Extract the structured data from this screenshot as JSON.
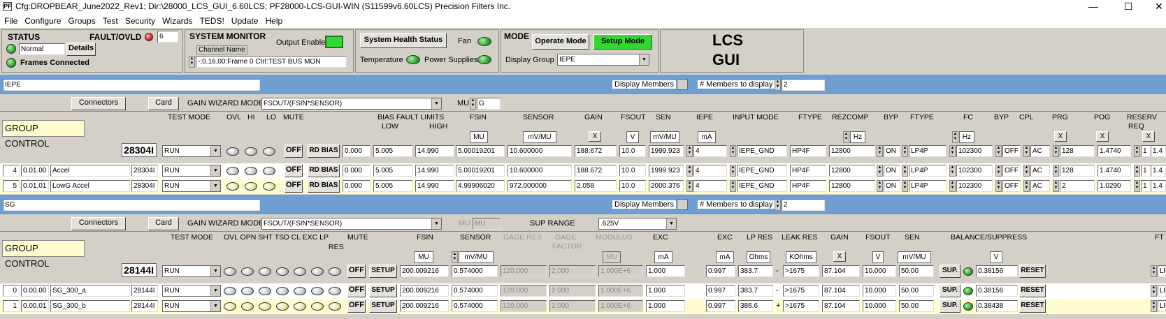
{
  "window": {
    "title": "Cfg:DROPBEAR_June2022_Rev1; Dir:\\28000_LCS_GUI_6.60LCS;   PF28000-LCS-GUI-WIN (S11599v6.60LCS) Precision Filters Inc.",
    "logo": "PF",
    "minimize": "—",
    "maximize": "☐",
    "close": "✕"
  },
  "menu": [
    "File",
    "Configure",
    "Groups",
    "Test",
    "Security",
    "Wizards",
    "TEDS!",
    "Update",
    "Help"
  ],
  "status": {
    "title": "STATUS",
    "fault_label": "FAULT/OVLD",
    "fault_count": "6",
    "state": "Normal",
    "details": "Details",
    "frames": "Frames Connected"
  },
  "monitor": {
    "title": "SYSTEM MONITOR",
    "channel_name_label": "Channel Name",
    "output_enable": "Output Enable",
    "channel_value": "-:0.16.00:Frame 0 Ctrl:TEST BUS MON"
  },
  "health": {
    "button": "System Health Status",
    "fan": "Fan",
    "temperature": "Temperature",
    "power": "Power Supplies"
  },
  "mode": {
    "title": "MODE",
    "operate": "Operate Mode",
    "setup": "Setup Mode",
    "display_group_label": "Display Group",
    "display_group_value": "IEPE"
  },
  "lcs": {
    "line1": "LCS",
    "line2": "GUI"
  },
  "iepe": {
    "name": "IEPE",
    "display_members": "Display Members",
    "members_label": "# Members to display",
    "members_value": "2",
    "connectors": "Connectors",
    "card": "Card",
    "wizard_label": "GAIN WIZARD MODE",
    "wizard_value": "FSOUT/(FSIN*SENSOR)",
    "mu_label": "MU",
    "mu_value": "G",
    "group_control": "GROUP CONTROL",
    "card_id": "28304I",
    "headers": {
      "test_mode": "TEST MODE",
      "ovl": "OVL",
      "hi": "HI",
      "lo": "LO",
      "mute": "MUTE",
      "bias": "BIAS FAULT LIMITS",
      "low": "LOW",
      "high": "HIGH",
      "fsin": "FSIN",
      "sensor": "SENSOR",
      "gain": "GAIN",
      "fsout": "FSOUT",
      "sen": "SEN",
      "iepe": "IEPE",
      "input_mode": "INPUT MODE",
      "ftype": "FTYPE",
      "rezcomp": "REZCOMP",
      "byp": "BYP",
      "ftype2": "FTYPE",
      "fc": "FC",
      "byp2": "BYP",
      "cpl": "CPL",
      "prg": "PRG",
      "pog": "POG",
      "reserv": "RESERV",
      "req": "REQ"
    },
    "units": {
      "fsin": "MU",
      "sensor": "mV/MU",
      "gain": "X",
      "fsout": "V",
      "sen": "mV/MU",
      "iepe": "mA",
      "rez": "Hz",
      "fc": "Hz",
      "prg": "X",
      "pog": "X",
      "res": "X"
    },
    "control_row": {
      "test_mode": "RUN",
      "mute": "OFF",
      "rdbias": "RD BIAS",
      "bias": "0.000",
      "low": "5.005",
      "high": "14.990",
      "fsin": "5.00019201",
      "sensor": "10.600000",
      "gain": "188.672",
      "fsout": "10.0",
      "sen": "1999.923",
      "iepe": "4",
      "input_mode": "IEPE_GND",
      "ftype": "HP4F",
      "rez": "12800",
      "byp": "ON",
      "ftype2": "LP4P",
      "fc": "102300",
      "byp2": "OFF",
      "cpl": "AC",
      "prg": "128",
      "pog": "1.4740",
      "req": "1",
      "extra": "1.4"
    },
    "rows": [
      {
        "num": "4",
        "addr": "0.01.00",
        "name": "Accel",
        "card": "28304I",
        "test_mode": "RUN",
        "mute": "OFF",
        "rdbias": "RD BIAS",
        "bias": "0.000",
        "low": "5.005",
        "high": "14.990",
        "fsin": "5.00019201",
        "sensor": "10.600000",
        "gain": "188.672",
        "fsout": "10.0",
        "sen": "1999.923",
        "iepe": "4",
        "input_mode": "IEPE_GND",
        "ftype": "HP4F",
        "rez": "12800",
        "byp": "ON",
        "ftype2": "LP4P",
        "fc": "102300",
        "byp2": "OFF",
        "cpl": "AC",
        "prg": "128",
        "pog": "1.4740",
        "req": "1",
        "extra": "1.4"
      },
      {
        "num": "5",
        "addr": "0.01.01",
        "name": "LowG Accel",
        "card": "28304I",
        "test_mode": "RUN",
        "mute": "OFF",
        "rdbias": "RD BIAS",
        "bias": "0.000",
        "low": "5.005",
        "high": "14.990",
        "fsin": "4.99906020",
        "sensor": "972.000000",
        "gain": "2.058",
        "fsout": "10.0",
        "sen": "2000.376",
        "iepe": "4",
        "input_mode": "IEPE_GND",
        "ftype": "HP4F",
        "rez": "12800",
        "byp": "ON",
        "ftype2": "LP4P",
        "fc": "102300",
        "byp2": "OFF",
        "cpl": "AC",
        "prg": "2",
        "pog": "1.0290",
        "req": "1",
        "extra": "1.4"
      }
    ]
  },
  "sg": {
    "name": "SG",
    "display_members": "Display Members",
    "members_label": "# Members to display",
    "members_value": "2",
    "connectors": "Connectors",
    "card": "Card",
    "wizard_label": "GAIN WIZARD MODE",
    "wizard_value": "FSOUT/(FSIN*SENSOR)",
    "mu_label": "MU",
    "mu_value": "MU",
    "sup_range_label": "SUP RANGE",
    "sup_range_value": ".625V",
    "group_control": "GROUP CONTROL",
    "card_id": "28144I",
    "headers": {
      "test_mode": "TEST MODE",
      "leds": "OVL OPN SHT TSD  CL   EXC LP",
      "res": "RES",
      "mute": "MUTE",
      "fsin": "FSIN",
      "sensor": "SENSOR",
      "gage_res": "GAGE RES",
      "gage_factor": "GAGE",
      "gage_factor2": "FACTOR",
      "modulus": "MODULUS",
      "exc": "EXC",
      "exc2": "EXC",
      "lp_res": "LP RES",
      "leak_res": "LEAK RES",
      "gain": "GAIN",
      "fsout": "FSOUT",
      "sen": "SEN",
      "balance": "BALANCE/SUPPRESS",
      "ft": "FT"
    },
    "units": {
      "fsin": "MU",
      "sensor": "mV/MU",
      "modulus": "MU",
      "exc": "mA",
      "exc2": "mA",
      "lp": "Ohms",
      "leak": "KOhms",
      "gain": "X",
      "fsout": "V",
      "sen": "mV/MU",
      "bal": "V"
    },
    "control_row": {
      "test_mode": "RUN",
      "mute": "OFF",
      "setup": "SETUP",
      "fsin": "200.009216",
      "sensor": "0.574000",
      "gage_res": "120.000",
      "gage_factor": "2.000",
      "modulus": "1.000E+6",
      "exc": "1.000",
      "exc2": "0.997",
      "lp": "383.7",
      "sign": "-",
      "leak": ">1675",
      "gain": "87.104",
      "fsout": "10.000",
      "sen": "50.00",
      "sup": "SUP.",
      "bal": "0.38156",
      "reset": "RESET",
      "ft": "LF"
    },
    "rows": [
      {
        "num": "0",
        "addr": "0.00.00",
        "name": "SG_300_a",
        "card": "28144I",
        "test_mode": "RUN",
        "mute": "OFF",
        "setup": "SETUP",
        "fsin": "200.009216",
        "sensor": "0.574000",
        "gage_res": "120.000",
        "gage_factor": "2.000",
        "modulus": "1.000E+6",
        "exc": "1.000",
        "exc2": "0.997",
        "lp": "383.7",
        "sign": "-",
        "leak": ">1675",
        "gain": "87.104",
        "fsout": "10.000",
        "sen": "50.00",
        "sup": "SUP.",
        "bal": "0.38156",
        "reset": "RESET",
        "ft": "LF"
      },
      {
        "num": "1",
        "addr": "0.00.01",
        "name": "SG_300_b",
        "card": "28144I",
        "test_mode": "RUN",
        "mute": "OFF",
        "setup": "SETUP",
        "fsin": "200.009216",
        "sensor": "0.574000",
        "gage_res": "120.000",
        "gage_factor": "2.000",
        "modulus": "1.000E+6",
        "exc": "1.000",
        "exc2": "0.997",
        "lp": "386.6",
        "sign": "+",
        "leak": ">1675",
        "gain": "87.104",
        "fsout": "10.000",
        "sen": "50.00",
        "sup": "SUP.",
        "bal": "0.38438",
        "reset": "RESET",
        "ft": "LF"
      }
    ]
  },
  "colors": {
    "blue_band": "#6f9fd2",
    "row_yellow": "#fffdd0",
    "led_green": "#2fa62f",
    "led_red": "#e02020",
    "setup_green": "#33d633"
  }
}
